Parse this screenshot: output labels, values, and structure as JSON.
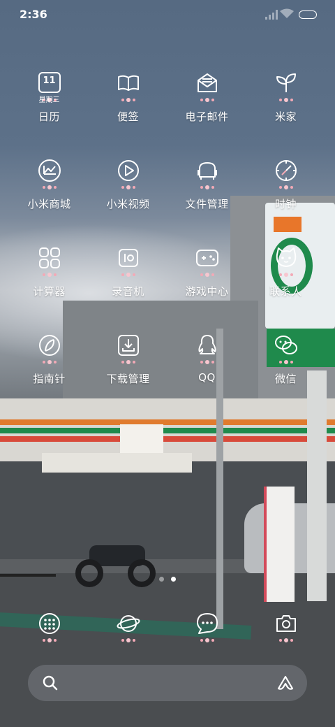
{
  "status_bar": {
    "time": "2:36"
  },
  "apps": [
    [
      {
        "label": "日历",
        "icon": "calendar-icon",
        "calendar_day": "11",
        "calendar_weekday": "星期三"
      },
      {
        "label": "便签",
        "icon": "notes-icon"
      },
      {
        "label": "电子邮件",
        "icon": "email-icon"
      },
      {
        "label": "米家",
        "icon": "mijia-icon"
      }
    ],
    [
      {
        "label": "小米商城",
        "icon": "mall-icon"
      },
      {
        "label": "小米视频",
        "icon": "video-icon"
      },
      {
        "label": "文件管理",
        "icon": "files-icon"
      },
      {
        "label": "时钟",
        "icon": "clock-icon"
      }
    ],
    [
      {
        "label": "计算器",
        "icon": "calculator-icon"
      },
      {
        "label": "录音机",
        "icon": "recorder-icon"
      },
      {
        "label": "游戏中心",
        "icon": "game-center-icon"
      },
      {
        "label": "联系人",
        "icon": "contacts-icon"
      }
    ],
    [
      {
        "label": "指南针",
        "icon": "compass-icon"
      },
      {
        "label": "下载管理",
        "icon": "downloads-icon"
      },
      {
        "label": "QQ",
        "icon": "qq-icon"
      },
      {
        "label": "微信",
        "icon": "wechat-icon"
      }
    ]
  ],
  "pager": {
    "pages": 2,
    "current": 2
  },
  "dock": [
    {
      "icon": "app-drawer-icon"
    },
    {
      "icon": "browser-icon"
    },
    {
      "icon": "messages-icon"
    },
    {
      "icon": "camera-icon"
    }
  ],
  "search_bar": {
    "left_icon": "search-icon",
    "right_icon": "assistant-icon"
  },
  "colors": {
    "icon_line": "#ffffff",
    "accent_dots": "#f3a9b6"
  }
}
